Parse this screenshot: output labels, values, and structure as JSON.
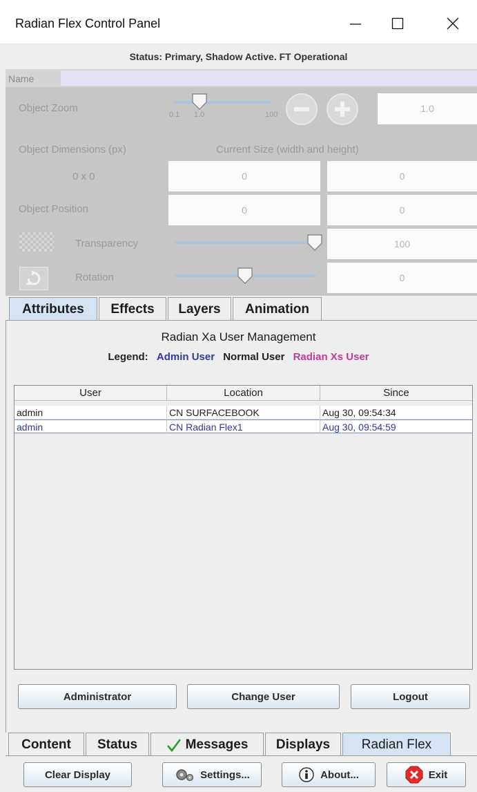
{
  "window": {
    "title": "Radian Flex Control Panel",
    "controls": {
      "minimize": "minimize-icon",
      "maximize": "maximize-icon",
      "close": "close-icon"
    }
  },
  "status": "Status: Primary, Shadow Active. FT Operational",
  "object_panel": {
    "name_label": "Name",
    "zoom": {
      "label": "Object Zoom",
      "tick_min": "0.1",
      "tick_one": "1.0",
      "tick_max": "100",
      "value": "1.0",
      "minus_icon": "minus-icon",
      "plus_icon": "plus-icon"
    },
    "dimensions": {
      "label": "Object Dimensions (px)",
      "current_size_label": "Current Size (width and height)",
      "value": "0 x 0",
      "width": "0",
      "height": "0"
    },
    "position": {
      "label": "Object Position",
      "x": "0",
      "y": "0"
    },
    "transparency": {
      "label": "Transparency",
      "value": "100",
      "icon": "checkerboard-icon"
    },
    "rotation": {
      "label": "Rotation",
      "value": "0",
      "icon": "rotate-icon"
    }
  },
  "top_tabs": [
    "Attributes",
    "Effects",
    "Layers",
    "Animation"
  ],
  "user_management": {
    "title": "Radian Xa User Management",
    "legend_label": "Legend:",
    "legend_admin": "Admin User",
    "legend_normal": "Normal User",
    "legend_xs": "Radian Xs User",
    "colors": {
      "admin": "#2f3aa0",
      "normal": "#222222",
      "xs": "#c0399b"
    },
    "columns": [
      "User",
      "Location",
      "Since"
    ],
    "rows": [
      {
        "user": "admin",
        "location": "CN SURFACEBOOK",
        "since": "Aug 30, 09:54:34"
      },
      {
        "user": "admin",
        "location": "CN Radian Flex1",
        "since": "Aug 30, 09:54:59"
      }
    ],
    "buttons": {
      "administrator": "Administrator",
      "change_user": "Change User",
      "logout": "Logout"
    }
  },
  "bottom_tabs": {
    "content": "Content",
    "status": "Status",
    "messages": "Messages",
    "displays": "Displays",
    "radian_flex": "Radian Flex"
  },
  "footer": {
    "clear_display": "Clear Display",
    "settings": "Settings...",
    "about": "About...",
    "exit": "Exit"
  }
}
